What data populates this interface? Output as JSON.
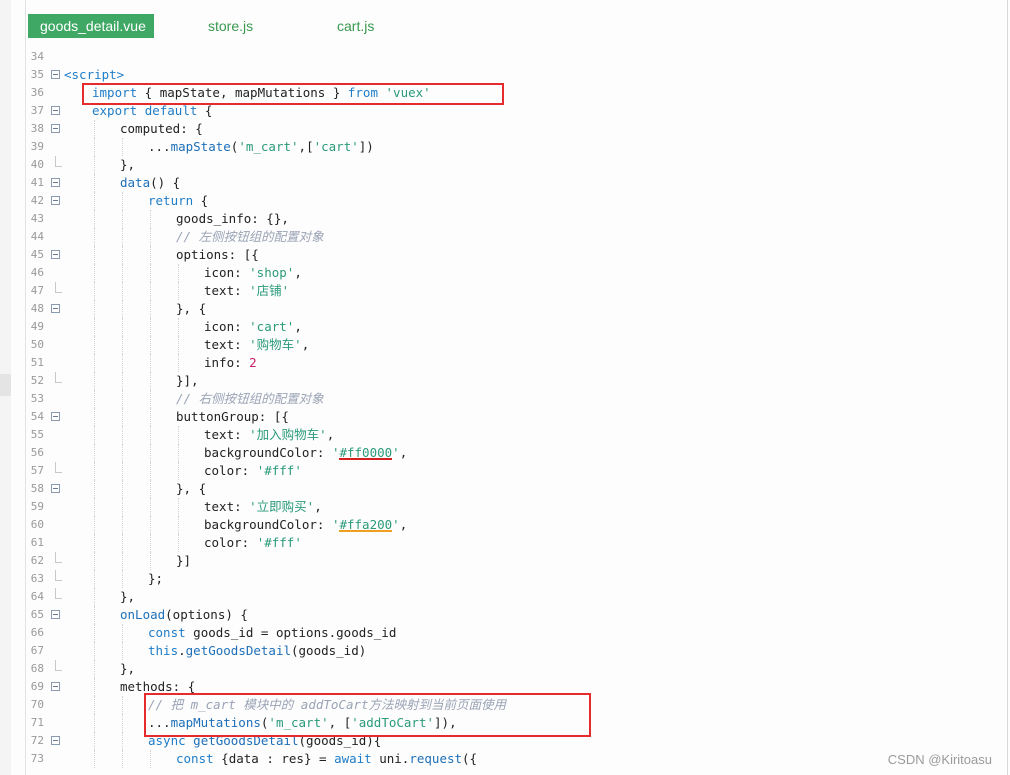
{
  "tabs": [
    {
      "label": "goods_detail.vue",
      "active": true
    },
    {
      "label": "store.js",
      "active": false
    },
    {
      "label": "cart.js",
      "active": false
    }
  ],
  "lines": [
    {
      "n": "34",
      "indent": 0,
      "fold": "none",
      "tokens": []
    },
    {
      "n": "35",
      "indent": 0,
      "fold": "open",
      "tokens": [
        {
          "t": "<script>",
          "c": "tag"
        }
      ]
    },
    {
      "n": "36",
      "indent": 1,
      "fold": "none",
      "tokens": [
        {
          "t": "import",
          "c": "kw"
        },
        {
          "t": " { mapState, mapMutations } ",
          "c": ""
        },
        {
          "t": "from",
          "c": "kw"
        },
        {
          "t": " ",
          "c": ""
        },
        {
          "t": "'vuex'",
          "c": "str"
        }
      ]
    },
    {
      "n": "37",
      "indent": 1,
      "fold": "open",
      "tokens": [
        {
          "t": "export",
          "c": "kw"
        },
        {
          "t": " ",
          "c": ""
        },
        {
          "t": "default",
          "c": "kw"
        },
        {
          "t": " {",
          "c": ""
        }
      ]
    },
    {
      "n": "38",
      "indent": 2,
      "fold": "open",
      "tokens": [
        {
          "t": "computed: {",
          "c": ""
        }
      ]
    },
    {
      "n": "39",
      "indent": 3,
      "fold": "none",
      "tokens": [
        {
          "t": "...",
          "c": ""
        },
        {
          "t": "mapState",
          "c": "fn"
        },
        {
          "t": "(",
          "c": ""
        },
        {
          "t": "'m_cart'",
          "c": "str"
        },
        {
          "t": ",[",
          "c": ""
        },
        {
          "t": "'cart'",
          "c": "str"
        },
        {
          "t": "])",
          "c": ""
        }
      ]
    },
    {
      "n": "40",
      "indent": 2,
      "fold": "end",
      "tokens": [
        {
          "t": "},",
          "c": ""
        }
      ]
    },
    {
      "n": "41",
      "indent": 2,
      "fold": "open",
      "tokens": [
        {
          "t": "data",
          "c": "fn"
        },
        {
          "t": "() {",
          "c": ""
        }
      ]
    },
    {
      "n": "42",
      "indent": 3,
      "fold": "open",
      "tokens": [
        {
          "t": "return",
          "c": "kw"
        },
        {
          "t": " {",
          "c": ""
        }
      ]
    },
    {
      "n": "43",
      "indent": 4,
      "fold": "none",
      "tokens": [
        {
          "t": "goods_info: {},",
          "c": ""
        }
      ]
    },
    {
      "n": "44",
      "indent": 4,
      "fold": "none",
      "tokens": [
        {
          "t": "// 左侧按钮组的配置对象",
          "c": "cm"
        }
      ]
    },
    {
      "n": "45",
      "indent": 4,
      "fold": "open",
      "tokens": [
        {
          "t": "options: [{",
          "c": ""
        }
      ]
    },
    {
      "n": "46",
      "indent": 5,
      "fold": "none",
      "tokens": [
        {
          "t": "icon: ",
          "c": ""
        },
        {
          "t": "'shop'",
          "c": "str"
        },
        {
          "t": ",",
          "c": ""
        }
      ]
    },
    {
      "n": "47",
      "indent": 5,
      "fold": "end",
      "tokens": [
        {
          "t": "text: ",
          "c": ""
        },
        {
          "t": "'店铺'",
          "c": "str"
        }
      ]
    },
    {
      "n": "48",
      "indent": 4,
      "fold": "open",
      "tokens": [
        {
          "t": "}, {",
          "c": ""
        }
      ]
    },
    {
      "n": "49",
      "indent": 5,
      "fold": "none",
      "tokens": [
        {
          "t": "icon: ",
          "c": ""
        },
        {
          "t": "'cart'",
          "c": "str"
        },
        {
          "t": ",",
          "c": ""
        }
      ]
    },
    {
      "n": "50",
      "indent": 5,
      "fold": "none",
      "tokens": [
        {
          "t": "text: ",
          "c": ""
        },
        {
          "t": "'购物车'",
          "c": "str"
        },
        {
          "t": ",",
          "c": ""
        }
      ]
    },
    {
      "n": "51",
      "indent": 5,
      "fold": "none",
      "tokens": [
        {
          "t": "info: ",
          "c": ""
        },
        {
          "t": "2",
          "c": "num"
        }
      ]
    },
    {
      "n": "52",
      "indent": 4,
      "fold": "end",
      "tokens": [
        {
          "t": "}],",
          "c": ""
        }
      ]
    },
    {
      "n": "53",
      "indent": 4,
      "fold": "none",
      "tokens": [
        {
          "t": "// 右侧按钮组的配置对象",
          "c": "cm"
        }
      ]
    },
    {
      "n": "54",
      "indent": 4,
      "fold": "open",
      "tokens": [
        {
          "t": "buttonGroup: [{",
          "c": ""
        }
      ]
    },
    {
      "n": "55",
      "indent": 5,
      "fold": "none",
      "tokens": [
        {
          "t": "text: ",
          "c": ""
        },
        {
          "t": "'加入购物车'",
          "c": "str"
        },
        {
          "t": ",",
          "c": ""
        }
      ]
    },
    {
      "n": "56",
      "indent": 5,
      "fold": "none",
      "tokens": [
        {
          "t": "backgroundColor: ",
          "c": ""
        },
        {
          "t": "'",
          "c": "str"
        },
        {
          "t": "#ff0000",
          "c": "str",
          "u": "#d42020"
        },
        {
          "t": "'",
          "c": "str"
        },
        {
          "t": ",",
          "c": ""
        }
      ]
    },
    {
      "n": "57",
      "indent": 5,
      "fold": "end",
      "tokens": [
        {
          "t": "color: ",
          "c": ""
        },
        {
          "t": "'#fff'",
          "c": "str"
        }
      ]
    },
    {
      "n": "58",
      "indent": 4,
      "fold": "open",
      "tokens": [
        {
          "t": "}, {",
          "c": ""
        }
      ]
    },
    {
      "n": "59",
      "indent": 5,
      "fold": "none",
      "tokens": [
        {
          "t": "text: ",
          "c": ""
        },
        {
          "t": "'立即购买'",
          "c": "str"
        },
        {
          "t": ",",
          "c": ""
        }
      ]
    },
    {
      "n": "60",
      "indent": 5,
      "fold": "none",
      "tokens": [
        {
          "t": "backgroundColor: ",
          "c": ""
        },
        {
          "t": "'",
          "c": "str"
        },
        {
          "t": "#ffa200",
          "c": "str",
          "u": "#f0a020"
        },
        {
          "t": "'",
          "c": "str"
        },
        {
          "t": ",",
          "c": ""
        }
      ]
    },
    {
      "n": "61",
      "indent": 5,
      "fold": "none",
      "tokens": [
        {
          "t": "color: ",
          "c": ""
        },
        {
          "t": "'#fff'",
          "c": "str"
        }
      ]
    },
    {
      "n": "62",
      "indent": 4,
      "fold": "end",
      "tokens": [
        {
          "t": "}]",
          "c": ""
        }
      ]
    },
    {
      "n": "63",
      "indent": 3,
      "fold": "end",
      "tokens": [
        {
          "t": "};",
          "c": ""
        }
      ]
    },
    {
      "n": "64",
      "indent": 2,
      "fold": "end",
      "tokens": [
        {
          "t": "},",
          "c": ""
        }
      ]
    },
    {
      "n": "65",
      "indent": 2,
      "fold": "open",
      "tokens": [
        {
          "t": "onLoad",
          "c": "fn"
        },
        {
          "t": "(options) {",
          "c": ""
        }
      ]
    },
    {
      "n": "66",
      "indent": 3,
      "fold": "none",
      "tokens": [
        {
          "t": "const",
          "c": "kw"
        },
        {
          "t": " goods_id = options.goods_id",
          "c": ""
        }
      ]
    },
    {
      "n": "67",
      "indent": 3,
      "fold": "none",
      "tokens": [
        {
          "t": "this",
          "c": "kw"
        },
        {
          "t": ".",
          "c": ""
        },
        {
          "t": "getGoodsDetail",
          "c": "fn"
        },
        {
          "t": "(goods_id)",
          "c": ""
        }
      ]
    },
    {
      "n": "68",
      "indent": 2,
      "fold": "end",
      "tokens": [
        {
          "t": "},",
          "c": ""
        }
      ]
    },
    {
      "n": "69",
      "indent": 2,
      "fold": "open",
      "tokens": [
        {
          "t": "methods: {",
          "c": ""
        }
      ]
    },
    {
      "n": "70",
      "indent": 3,
      "fold": "none",
      "tokens": [
        {
          "t": "// 把 m_cart 模块中的 addToCart方法映射到当前页面使用",
          "c": "cm"
        }
      ]
    },
    {
      "n": "71",
      "indent": 3,
      "fold": "none",
      "tokens": [
        {
          "t": "...",
          "c": ""
        },
        {
          "t": "mapMutations",
          "c": "fn"
        },
        {
          "t": "(",
          "c": ""
        },
        {
          "t": "'m_cart'",
          "c": "str"
        },
        {
          "t": ", [",
          "c": ""
        },
        {
          "t": "'addToCart'",
          "c": "str"
        },
        {
          "t": "]),",
          "c": ""
        }
      ]
    },
    {
      "n": "72",
      "indent": 3,
      "fold": "open",
      "tokens": [
        {
          "t": "async",
          "c": "kw"
        },
        {
          "t": " ",
          "c": ""
        },
        {
          "t": "getGoodsDetail",
          "c": "fn"
        },
        {
          "t": "(goods_id){",
          "c": ""
        }
      ]
    },
    {
      "n": "73",
      "indent": 4,
      "fold": "none",
      "tokens": [
        {
          "t": "const",
          "c": "kw"
        },
        {
          "t": " {data : res} = ",
          "c": ""
        },
        {
          "t": "await",
          "c": "kw"
        },
        {
          "t": " uni.",
          "c": ""
        },
        {
          "t": "request",
          "c": "fn"
        },
        {
          "t": "({",
          "c": ""
        }
      ]
    }
  ],
  "watermark": "CSDN @Kiritoasu"
}
